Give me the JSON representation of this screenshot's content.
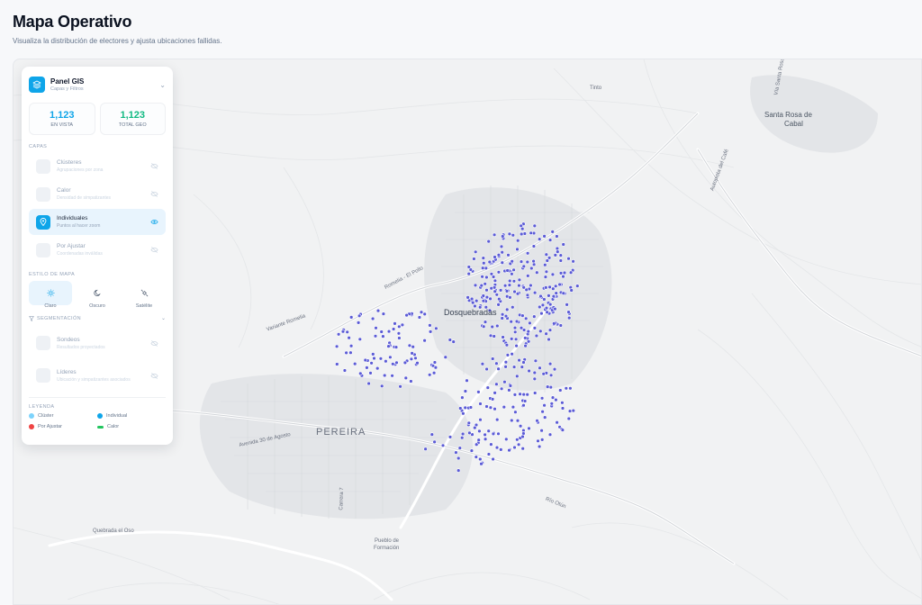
{
  "header": {
    "title": "Mapa Operativo",
    "subtitle": "Visualiza la distribución de electores y ajusta ubicaciones fallidas."
  },
  "map": {
    "labels": {
      "pereira": "PEREIRA",
      "dosquebradas": "Dosquebradas",
      "santa_rosa_1": "Santa Rosa de",
      "santa_rosa_2": "Cabal",
      "la_capilla": "La Capilla",
      "tinto": "Tinto",
      "puerto_caldas": "Quebrada el Oso",
      "pueblo_1": "Pueblo de",
      "pueblo_2": "Formación",
      "road_avenida_30": "Avenida 30 de Agosto",
      "road_la_popa": "Autopista del Café",
      "road_romelia": "Variante Romelia",
      "road_el_pollo": "Romelia - El Pollo",
      "road_la_paz": "Río Otún",
      "road_otun": "Río Otún",
      "road_santa_rosa": "Vía Santa Rosa",
      "road_cra": "Carrera 7"
    },
    "point_color": "#5b5bd6"
  },
  "panel": {
    "title": "Panel GIS",
    "subtitle": "Capas y Filtros",
    "stats": [
      {
        "value": "1,123",
        "label": "EN VISTA",
        "color": "#0ea5e9"
      },
      {
        "value": "1,123",
        "label": "TOTAL GEO",
        "color": "#10b981"
      }
    ],
    "layers_label": "CAPAS",
    "layers": [
      {
        "name": "Clústeres",
        "desc": "Agrupaciones por zona",
        "icon": "clusters-icon"
      },
      {
        "name": "Calor",
        "desc": "Densidad de simpatizantes",
        "icon": "heat-icon"
      },
      {
        "name": "Individuales",
        "desc": "Puntos al hacer zoom",
        "icon": "pin-icon"
      },
      {
        "name": "Por Ajustar",
        "desc": "Coordenadas inválidas",
        "icon": "adjust-icon"
      }
    ],
    "style_label": "ESTILO DE MAPA",
    "styles": [
      {
        "label": "Claro",
        "icon": "sun-icon"
      },
      {
        "label": "Oscuro",
        "icon": "moon-icon"
      },
      {
        "label": "Satélite",
        "icon": "satellite-icon"
      }
    ],
    "segmentation_label": "SEGMENTACIÓN",
    "segments": [
      {
        "name": "Sondeos",
        "desc": "Resultados proyectados"
      },
      {
        "name": "Líderes",
        "desc": "Ubicación y simpatizantes asociados"
      }
    ],
    "legend_label": "LEYENDA",
    "legend": [
      {
        "label": "Clúster",
        "color": "#7dd3fc",
        "shape": "dot"
      },
      {
        "label": "Individual",
        "color": "#0ea5e9",
        "shape": "dot"
      },
      {
        "label": "Por Ajustar",
        "color": "#ef4444",
        "shape": "dot"
      },
      {
        "label": "Calor",
        "color": "#22c55e",
        "shape": "bar"
      }
    ]
  }
}
